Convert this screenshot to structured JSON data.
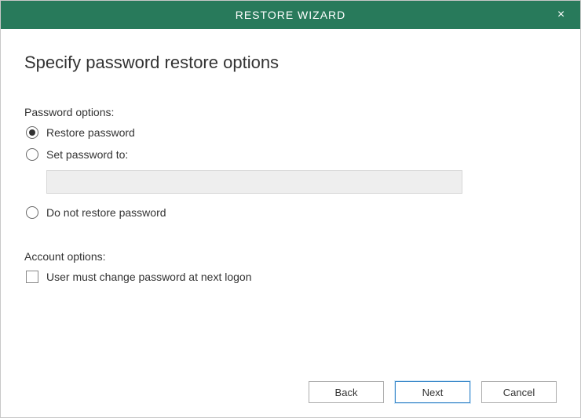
{
  "titlebar": {
    "title": "RESTORE WIZARD",
    "close_label": "×"
  },
  "heading": "Specify password restore options",
  "password_options": {
    "section_label": "Password options:",
    "radios": [
      {
        "label": "Restore password",
        "selected": true
      },
      {
        "label": "Set password to:",
        "selected": false
      },
      {
        "label": "Do not restore password",
        "selected": false
      }
    ],
    "password_value": ""
  },
  "account_options": {
    "section_label": "Account options:",
    "checkbox": {
      "label": "User must change password at next logon",
      "checked": false
    }
  },
  "footer": {
    "back": "Back",
    "next": "Next",
    "cancel": "Cancel"
  }
}
